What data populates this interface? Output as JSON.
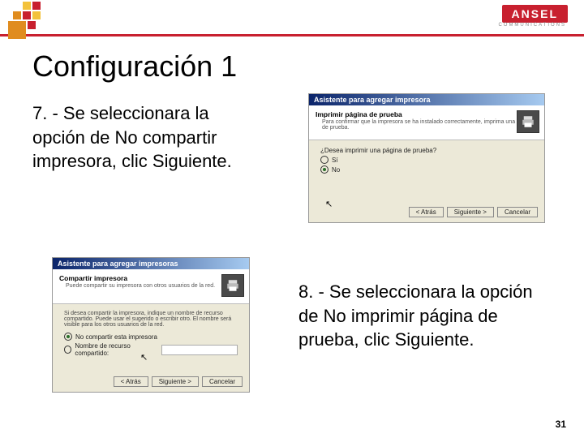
{
  "brand": {
    "name": "ANSEL",
    "sub": "COMMUNICATIONS"
  },
  "title": "Configuración 1",
  "step7": "7. - Se seleccionara la opción de No compartir impresora, clic Siguiente.",
  "step8": "8. - Se seleccionara la opción de No imprimir página de prueba, clic Siguiente.",
  "wizA": {
    "title": "Asistente para agregar impresora",
    "headTitle": "Imprimir página de prueba",
    "headSub": "Para confirmar que la impresora se ha instalado correctamente, imprima una página de prueba.",
    "question": "¿Desea imprimir una página de prueba?",
    "opt1": "Sí",
    "opt2": "No",
    "back": "< Atrás",
    "next": "Siguiente >",
    "cancel": "Cancelar"
  },
  "wizB": {
    "title": "Asistente para agregar impresoras",
    "headTitle": "Compartir impresora",
    "headSub": "Puede compartir su impresora con otros usuarios de la red.",
    "desc": "Si desea compartir la impresora, indique un nombre de recurso compartido. Puede usar el sugerido o escribir otro. El nombre será visible para los otros usuarios de la red.",
    "opt1": "No compartir esta impresora",
    "opt2Label": "Nombre de recurso compartido:",
    "back": "< Atrás",
    "next": "Siguiente >",
    "cancel": "Cancelar"
  },
  "pageNumber": "31",
  "logoColors": {
    "orange": "#e08c1f",
    "red": "#c8202f",
    "yellow": "#f3c23b"
  }
}
